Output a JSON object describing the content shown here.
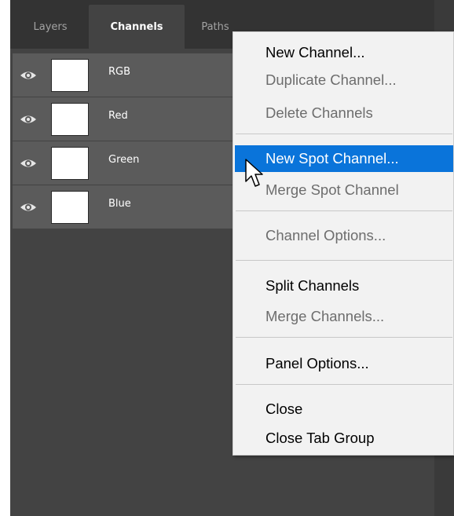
{
  "tabs": [
    {
      "label": "Layers",
      "active": false
    },
    {
      "label": "Channels",
      "active": true
    },
    {
      "label": "Paths",
      "active": false
    }
  ],
  "channels": [
    {
      "name": "RGB",
      "visible": true
    },
    {
      "name": "Red",
      "visible": true
    },
    {
      "name": "Green",
      "visible": true
    },
    {
      "name": "Blue",
      "visible": true
    }
  ],
  "menu": {
    "groups": [
      [
        {
          "label": "New Channel...",
          "enabled": true
        },
        {
          "label": "Duplicate Channel...",
          "enabled": false
        },
        {
          "label": "Delete Channels",
          "enabled": false
        }
      ],
      [
        {
          "label": "New Spot Channel...",
          "enabled": true,
          "highlighted": true
        },
        {
          "label": "Merge Spot Channel",
          "enabled": false
        }
      ],
      [
        {
          "label": "Channel Options...",
          "enabled": false
        }
      ],
      [
        {
          "label": "Split Channels",
          "enabled": true
        },
        {
          "label": "Merge Channels...",
          "enabled": false
        }
      ],
      [
        {
          "label": "Panel Options...",
          "enabled": true
        }
      ],
      [
        {
          "label": "Close",
          "enabled": true
        },
        {
          "label": "Close Tab Group",
          "enabled": true
        }
      ]
    ]
  },
  "colors": {
    "panel_bg": "#434343",
    "row_bg": "#5b5b5b",
    "menu_bg": "#f2f2f2",
    "highlight": "#0a74da"
  },
  "icons": {
    "visibility": "eye-icon",
    "panel_menu": "hamburger-menu-icon",
    "pointer": "mouse-cursor-icon"
  }
}
